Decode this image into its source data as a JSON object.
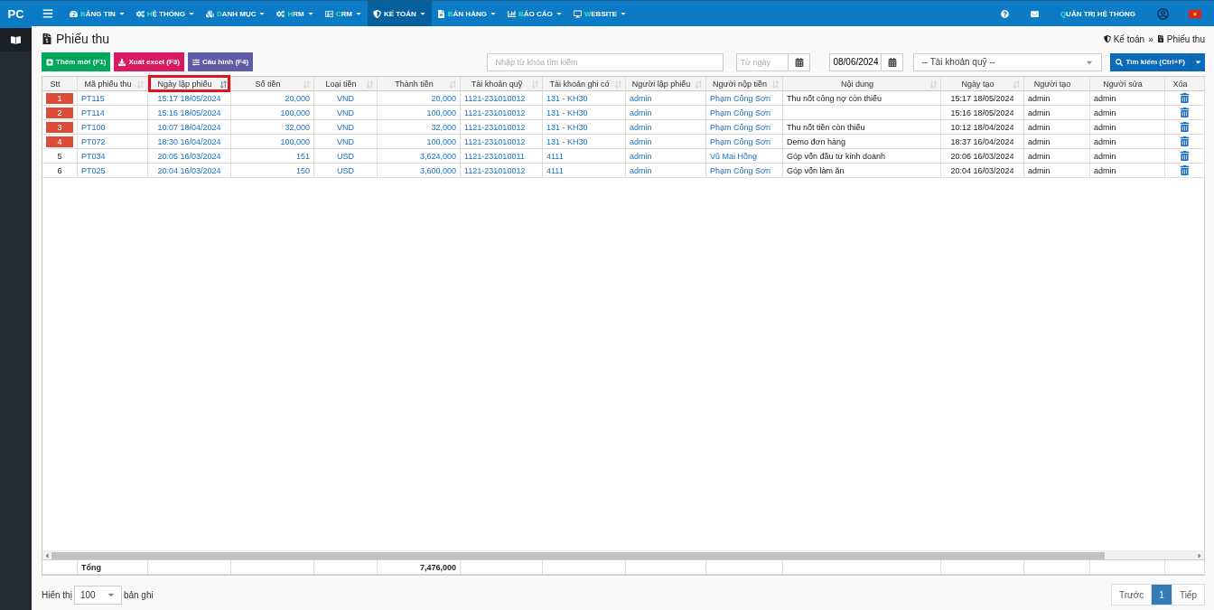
{
  "nav": {
    "brand": "PC",
    "menu": [
      {
        "label": "BẢNG TIN",
        "selected": false
      },
      {
        "label": "HỆ THỐNG",
        "selected": false
      },
      {
        "label": "DANH MỤC",
        "selected": false
      },
      {
        "label": "HRM",
        "selected": false
      },
      {
        "label": "CRM",
        "selected": false
      },
      {
        "label": "KẾ TOÁN",
        "selected": true
      },
      {
        "label": "BÁN HÀNG",
        "selected": false
      },
      {
        "label": "BÁO CÁO",
        "selected": false
      },
      {
        "label": "WEBSITE",
        "selected": false
      }
    ],
    "user": "QUẢN TRỊ HỆ THỐNG"
  },
  "page": {
    "title": "Phiếu thu",
    "breadcrumb": [
      "Kế toán",
      "Phiếu thu"
    ],
    "breadcrumb_separator": "»"
  },
  "toolbar": {
    "buttons": [
      {
        "label": "Thêm mới (F1)",
        "kind": "add"
      },
      {
        "label": "Xuất excel (F3)",
        "kind": "export"
      },
      {
        "label": "Cấu hình (F4)",
        "kind": "config"
      }
    ],
    "search": {
      "placeholder": "Nhập từ khóa tìm kiếm"
    },
    "date_from": {
      "placeholder": "Từ ngày"
    },
    "date_to": {
      "value": "08/06/2024"
    },
    "account": {
      "value": "-- Tài khoản quỹ --"
    },
    "search_button": "Tìm kiếm (Ctrl+F)"
  },
  "table": {
    "columns": [
      {
        "label": "Stt",
        "sortable": false,
        "highlighted": false
      },
      {
        "label": "Mã phiếu thu",
        "sortable": true,
        "highlighted": false
      },
      {
        "label": "Ngày lập phiếu",
        "sortable": true,
        "highlighted": true
      },
      {
        "label": "Số tiền",
        "sortable": true,
        "highlighted": false
      },
      {
        "label": "Loại tiền",
        "sortable": true,
        "highlighted": false
      },
      {
        "label": "Thành tiền",
        "sortable": true,
        "highlighted": false
      },
      {
        "label": "Tài khoản quỹ",
        "sortable": true,
        "highlighted": false
      },
      {
        "label": "Tài khoản ghi có",
        "sortable": true,
        "highlighted": false
      },
      {
        "label": "Người lập phiếu",
        "sortable": true,
        "highlighted": false
      },
      {
        "label": "Người nộp tiền",
        "sortable": true,
        "highlighted": false
      },
      {
        "label": "Nội dung",
        "sortable": true,
        "highlighted": false
      },
      {
        "label": "Ngày tạo",
        "sortable": true,
        "highlighted": false
      },
      {
        "label": "Người tạo",
        "sortable": false,
        "highlighted": false
      },
      {
        "label": "Người sửa",
        "sortable": false,
        "highlighted": false
      },
      {
        "label": "Xóa",
        "sortable": false,
        "highlighted": false
      }
    ],
    "rows": [
      {
        "flagged": true,
        "cells": [
          "1",
          "PT115",
          "15:17 18/05/2024",
          "20,000",
          "VND",
          "20,000",
          "1121-231010012",
          "131 - KH30",
          "admin",
          "Phạm Công Sơn",
          "Thu nốt công nợ còn thiếu",
          "15:17 18/05/2024",
          "admin",
          "admin"
        ]
      },
      {
        "flagged": true,
        "cells": [
          "2",
          "PT114",
          "15:16 18/05/2024",
          "100,000",
          "VND",
          "100,000",
          "1121-231010012",
          "131 - KH30",
          "admin",
          "Phạm Công Sơn",
          "",
          "15:16 18/05/2024",
          "admin",
          "admin"
        ]
      },
      {
        "flagged": true,
        "cells": [
          "3",
          "PT100",
          "10:07 18/04/2024",
          "32,000",
          "VND",
          "32,000",
          "1121-231010012",
          "131 - KH30",
          "admin",
          "Phạm Công Sơn",
          "Thu nốt tiền còn thiếu",
          "10:12 18/04/2024",
          "admin",
          "admin"
        ]
      },
      {
        "flagged": true,
        "cells": [
          "4",
          "PT072",
          "18:30 16/04/2024",
          "100,000",
          "VND",
          "100,000",
          "1121-231010012",
          "131 - KH30",
          "admin",
          "Phạm Công Sơn",
          "Demo đơn hàng",
          "18:37 16/04/2024",
          "admin",
          "admin"
        ]
      },
      {
        "flagged": false,
        "cells": [
          "5",
          "PT034",
          "20:05 16/03/2024",
          "151",
          "USD",
          "3,624,000",
          "1121-231010011",
          "4111",
          "admin",
          "Vũ Mai Hồng",
          "Góp vốn đầu tư kinh doanh",
          "20:06 16/03/2024",
          "admin",
          "admin"
        ]
      },
      {
        "flagged": false,
        "cells": [
          "6",
          "PT025",
          "20:04 16/03/2024",
          "150",
          "USD",
          "3,600,000",
          "1121-231010012",
          "4111",
          "admin",
          "Phạm Công Sơn",
          "Góp vốn làm ăn",
          "20:04 16/03/2024",
          "admin",
          "admin"
        ]
      }
    ],
    "total": {
      "label": "Tổng",
      "amount": "7,476,000"
    }
  },
  "footer": {
    "show_label": "Hiển thị",
    "page_size": "100",
    "records_label": "bản ghi",
    "pagination": [
      {
        "label": "Trước",
        "selected": false
      },
      {
        "label": "1",
        "selected": true
      },
      {
        "label": "Tiếp",
        "selected": false
      }
    ]
  }
}
